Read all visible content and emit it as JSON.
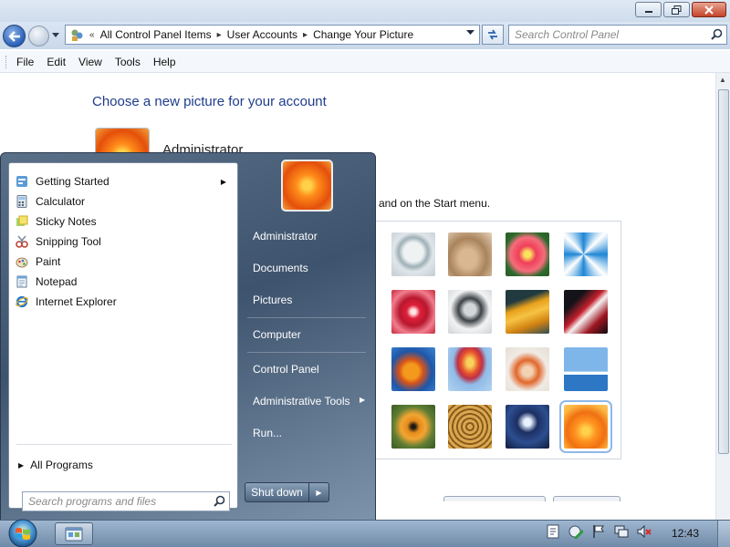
{
  "window": {
    "address_crumbs": [
      "All Control Panel Items",
      "User Accounts",
      "Change Your Picture"
    ],
    "search_placeholder": "Search Control Panel",
    "menu": [
      "File",
      "Edit",
      "View",
      "Tools",
      "Help"
    ]
  },
  "page": {
    "heading": "Choose a new picture for your account",
    "account_name": "Administrator",
    "hint_text": "and on the Start menu.",
    "pictures": [
      "compass",
      "kitten",
      "pink-flower",
      "pinwheel",
      "red-star",
      "jacks",
      "stairs",
      "origami-crane",
      "fish",
      "hot-air-balloon",
      "figurine",
      "sailboat",
      "butterfly",
      "woven-basket",
      "lighthouse",
      "orange-flower"
    ],
    "selected_picture": "orange-flower"
  },
  "start_menu": {
    "programs": [
      {
        "label": "Getting Started",
        "icon": "getting-started-icon",
        "has_submenu": true
      },
      {
        "label": "Calculator",
        "icon": "calculator-icon",
        "has_submenu": false
      },
      {
        "label": "Sticky Notes",
        "icon": "sticky-notes-icon",
        "has_submenu": false
      },
      {
        "label": "Snipping Tool",
        "icon": "snipping-tool-icon",
        "has_submenu": false
      },
      {
        "label": "Paint",
        "icon": "paint-icon",
        "has_submenu": false
      },
      {
        "label": "Notepad",
        "icon": "notepad-icon",
        "has_submenu": false
      },
      {
        "label": "Internet Explorer",
        "icon": "internet-explorer-icon",
        "has_submenu": false
      }
    ],
    "all_programs": "All Programs",
    "search_placeholder": "Search programs and files",
    "right_items": [
      "Administrator",
      "Documents",
      "Pictures",
      "Computer",
      "Control Panel",
      "Administrative Tools",
      "Run..."
    ],
    "shutdown_label": "Shut down"
  },
  "taskbar": {
    "clock": "12:43"
  }
}
